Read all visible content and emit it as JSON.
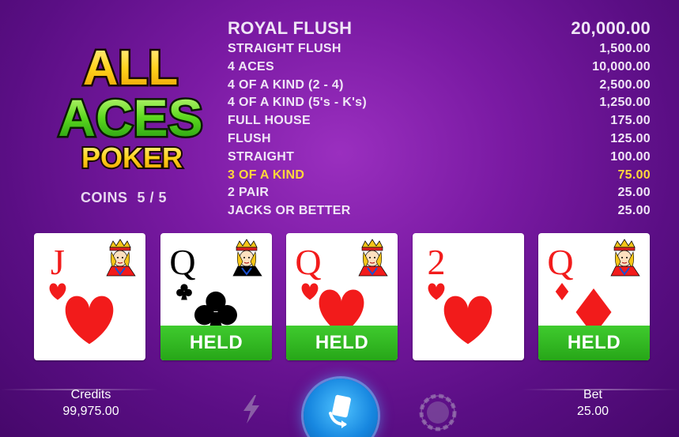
{
  "logo": {
    "line1": "ALL",
    "line2": "ACES",
    "line3": "POKER"
  },
  "coins": {
    "label": "COINS",
    "value": "5 / 5"
  },
  "paytable": [
    {
      "hand": "ROYAL FLUSH",
      "payout": "20,000.00"
    },
    {
      "hand": "STRAIGHT FLUSH",
      "payout": "1,500.00"
    },
    {
      "hand": "4 ACES",
      "payout": "10,000.00"
    },
    {
      "hand": "4 OF A KIND (2 - 4)",
      "payout": "2,500.00"
    },
    {
      "hand": "4 OF A KIND (5's - K's)",
      "payout": "1,250.00"
    },
    {
      "hand": "FULL HOUSE",
      "payout": "175.00"
    },
    {
      "hand": "FLUSH",
      "payout": "125.00"
    },
    {
      "hand": "STRAIGHT",
      "payout": "100.00"
    },
    {
      "hand": "3 OF A KIND",
      "payout": "75.00"
    },
    {
      "hand": "2 PAIR",
      "payout": "25.00"
    },
    {
      "hand": "JACKS OR BETTER",
      "payout": "25.00"
    }
  ],
  "highlight_color": "#ffd83a",
  "cards": [
    {
      "rank": "J",
      "suit": "hearts",
      "held": false,
      "held_label": ""
    },
    {
      "rank": "Q",
      "suit": "clubs",
      "held": true,
      "held_label": "HELD"
    },
    {
      "rank": "Q",
      "suit": "hearts",
      "held": true,
      "held_label": "HELD"
    },
    {
      "rank": "2",
      "suit": "hearts",
      "held": false,
      "held_label": ""
    },
    {
      "rank": "Q",
      "suit": "diamonds",
      "held": true,
      "held_label": "HELD"
    }
  ],
  "held_color": "#2fb820",
  "credits": {
    "label": "Credits",
    "value": "99,975.00"
  },
  "bet": {
    "label": "Bet",
    "value": "25.00"
  },
  "icons": {
    "turbo": "lightning-icon",
    "deal": "deal-cards-icon",
    "chip": "chip-icon"
  }
}
